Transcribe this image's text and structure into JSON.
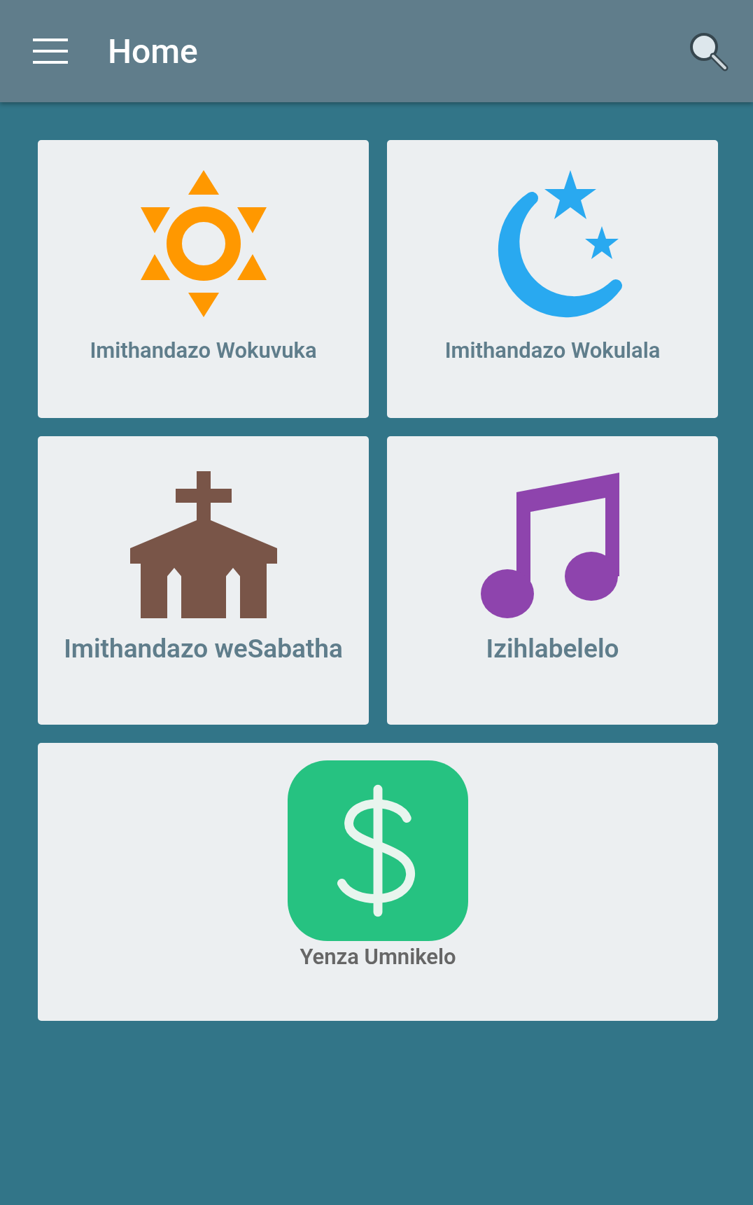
{
  "app_bar": {
    "title": "Home"
  },
  "tiles": [
    {
      "kind": "sun",
      "label": "Imithandazo Wokuvuka"
    },
    {
      "kind": "moon",
      "label": "Imithandazo Wokulala"
    },
    {
      "kind": "church",
      "label": "Imithandazo weSabatha"
    },
    {
      "kind": "music",
      "label": "Izihlabelelo"
    },
    {
      "kind": "dollar",
      "label": "Yenza Umnikelo"
    }
  ]
}
